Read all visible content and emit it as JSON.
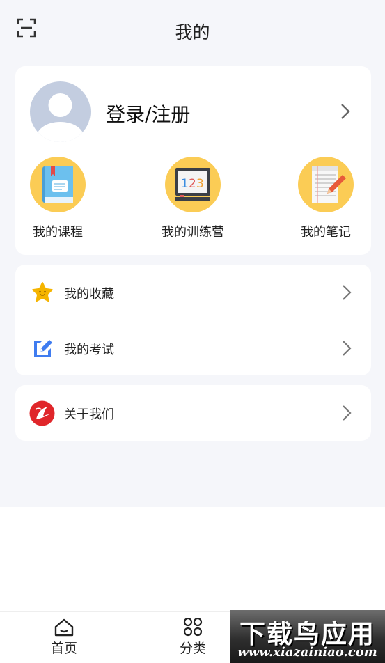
{
  "header": {
    "title": "我的",
    "scan_icon": "scan-icon"
  },
  "profile": {
    "login_label": "登录/注册",
    "avatar_icon": "default-avatar"
  },
  "quick_links": [
    {
      "label": "我的课程",
      "icon": "book-icon"
    },
    {
      "label": "我的训练营",
      "icon": "blackboard-123-icon"
    },
    {
      "label": "我的笔记",
      "icon": "notepad-pencil-icon"
    }
  ],
  "menu": {
    "favorites": {
      "label": "我的收藏",
      "icon": "star-icon"
    },
    "exams": {
      "label": "我的考试",
      "icon": "edit-document-icon"
    },
    "about": {
      "label": "关于我们",
      "icon": "app-logo-icon"
    }
  },
  "tabbar": [
    {
      "label": "首页",
      "icon": "home-icon"
    },
    {
      "label": "分类",
      "icon": "category-icon"
    }
  ],
  "watermark": {
    "top": "下载鸟应用",
    "bottom": "www.xiazainiao.com"
  },
  "colors": {
    "background": "#f5f6fa",
    "card": "#ffffff",
    "quick_circle": "#fbcc55",
    "avatar": "#c3cde0",
    "star": "#f5b400",
    "edit_blue": "#3f7cf0",
    "logo_red": "#e0262a"
  }
}
